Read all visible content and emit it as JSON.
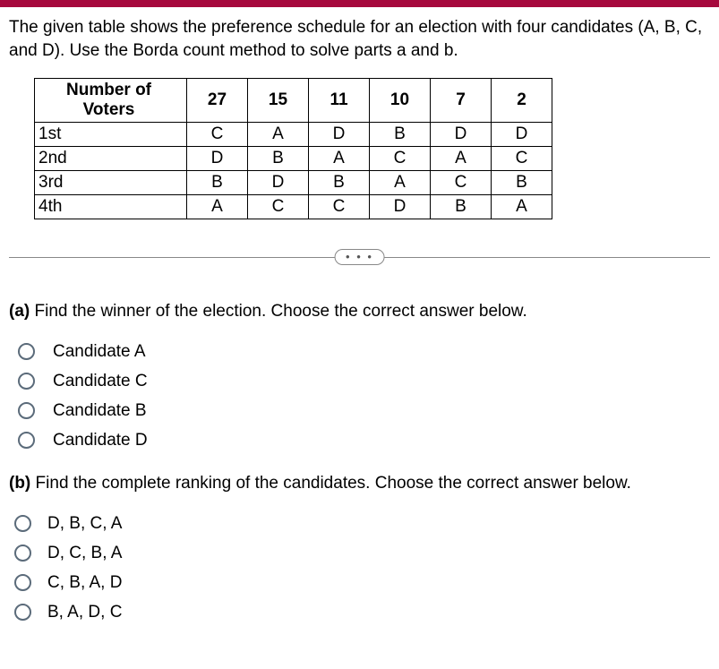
{
  "problem_statement": "The given table shows the preference schedule for an election with four candidates (A, B, C, and D). Use the Borda count method to solve parts a and b.",
  "table": {
    "header_label": "Number of Voters",
    "columns": [
      "27",
      "15",
      "11",
      "10",
      "7",
      "2"
    ],
    "rows": [
      {
        "label": "1st",
        "cells": [
          "C",
          "A",
          "D",
          "B",
          "D",
          "D"
        ]
      },
      {
        "label": "2nd",
        "cells": [
          "D",
          "B",
          "A",
          "C",
          "A",
          "C"
        ]
      },
      {
        "label": "3rd",
        "cells": [
          "B",
          "D",
          "B",
          "A",
          "C",
          "B"
        ]
      },
      {
        "label": "4th",
        "cells": [
          "A",
          "C",
          "C",
          "D",
          "B",
          "A"
        ]
      }
    ]
  },
  "divider_dots": "• • •",
  "part_a": {
    "label": "(a)",
    "text": " Find the winner of the election. Choose the correct answer below.",
    "options": [
      "Candidate A",
      "Candidate C",
      "Candidate B",
      "Candidate D"
    ]
  },
  "part_b": {
    "label": "(b)",
    "text": " Find the complete ranking of the candidates. Choose the correct answer below.",
    "options": [
      "D, B, C, A",
      "D, C, B, A",
      "C, B, A, D",
      "B, A, D, C"
    ]
  }
}
